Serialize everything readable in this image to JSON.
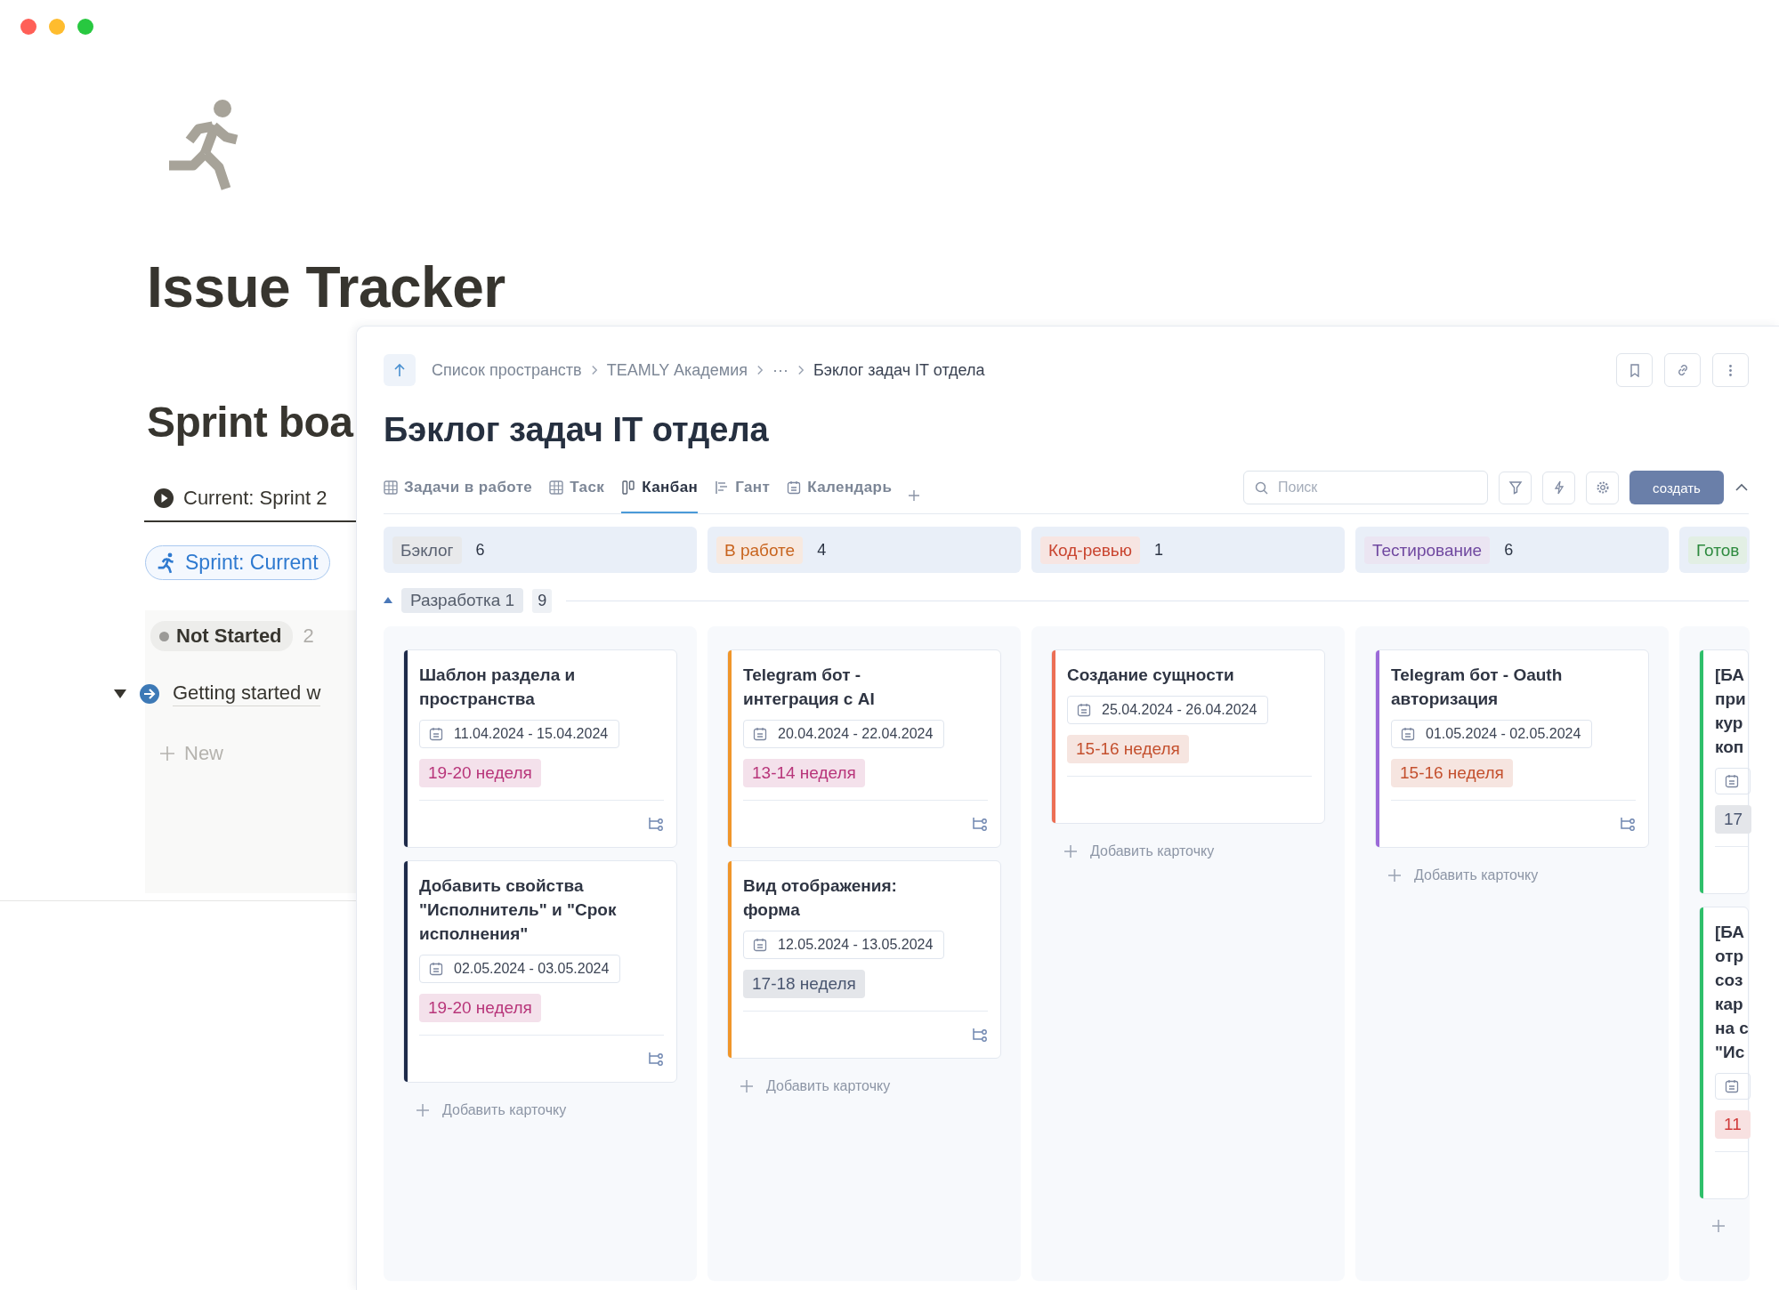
{
  "window_controls": [
    {
      "color": "#ff5f57"
    },
    {
      "color": "#febc2e"
    },
    {
      "color": "#28c840"
    }
  ],
  "page": {
    "title": "Issue Tracker",
    "section_title": "Sprint boa",
    "view_tab": {
      "label": "Current: Sprint 2",
      "selected": true
    },
    "filter_chip": "Sprint: Current",
    "group": {
      "status": "Not Started",
      "count": "2",
      "expanded": true,
      "items": [
        {
          "title": "Getting started w"
        }
      ],
      "new_label": "New"
    }
  },
  "panel": {
    "breadcrumb": [
      "Список пространств",
      "TEAMLY Академия",
      "···",
      "Бэклог задач IT отдела"
    ],
    "title": "Бэклог задач IT отдела",
    "views": [
      {
        "label": "Задачи в работе",
        "kind": "table",
        "selected": false
      },
      {
        "label": "Таск",
        "kind": "table",
        "selected": false
      },
      {
        "label": "Канбан",
        "kind": "kanban",
        "selected": true
      },
      {
        "label": "Гант",
        "kind": "gantt",
        "selected": false
      },
      {
        "label": "Календарь",
        "kind": "calendar",
        "selected": false
      }
    ],
    "search": {
      "placeholder": "Поиск"
    },
    "create_button": "создать",
    "swimlane": {
      "name": "Разработка 1",
      "count": "9",
      "expanded": true
    },
    "columns": [
      {
        "status_tag": {
          "label": "Бэклог",
          "color": "#5a6272"
        },
        "count": "6",
        "color": "#1e2b4a",
        "add_label": "Добавить карточку",
        "cards": [
          {
            "title": "Шаблон раздела и пространства",
            "dates": "11.04.2024 - 15.04.2024",
            "tag": {
              "label": "19-20 неделя",
              "color": "#b8357a"
            },
            "subtasks": true
          },
          {
            "title": "Добавить свойства \"Исполнитель\" и \"Срок исполнения\"",
            "dates": "02.05.2024 - 03.05.2024",
            "tag": {
              "label": "19-20 неделя",
              "color": "#b8357a"
            },
            "subtasks": true
          }
        ]
      },
      {
        "status_tag": {
          "label": "В работе",
          "color": "#c8641e"
        },
        "count": "4",
        "color": "#f0962a",
        "add_label": "Добавить карточку",
        "cards": [
          {
            "title": "Telegram бот - интеграция с AI",
            "dates": "20.04.2024 - 22.04.2024",
            "tag": {
              "label": "13-14 неделя",
              "color": "#b8357a"
            },
            "subtasks": true
          },
          {
            "title": "Вид отображения: форма",
            "dates": "12.05.2024 - 13.05.2024",
            "tag": {
              "label": "17-18 неделя",
              "color": "#4a5670"
            },
            "subtasks": true
          }
        ]
      },
      {
        "status_tag": {
          "label": "Код-ревью",
          "color": "#c9442f"
        },
        "count": "1",
        "color": "#ec6f55",
        "add_label": "Добавить карточку",
        "cards": [
          {
            "title": "Создание сущности",
            "dates": "25.04.2024 - 26.04.2024",
            "tag": {
              "label": "15-16 неделя",
              "color": "#c4502e"
            },
            "subtasks": false
          }
        ]
      },
      {
        "status_tag": {
          "label": "Тестирование",
          "color": "#7048a0"
        },
        "count": "6",
        "color": "#9b6ad8",
        "add_label": "Добавить карточку",
        "cards": [
          {
            "title": "Telegram бот - Oauth авторизация",
            "dates": "01.05.2024 - 02.05.2024",
            "tag": {
              "label": "15-16 неделя",
              "color": "#c4502e"
            },
            "subtasks": true
          }
        ]
      },
      {
        "status_tag": {
          "label": "Готов",
          "color": "#2d8a3e"
        },
        "color": "#2fbf6a",
        "cards": [
          {
            "title": "[БА при кур коп",
            "tag": {
              "label": "17",
              "color": "#4a5670"
            },
            "subtasks": false
          },
          {
            "title": "[БА отр соз кар на с \"Ис",
            "tag": {
              "label": "11",
              "color": "#d03a3a"
            },
            "subtasks": false
          }
        ]
      }
    ]
  }
}
